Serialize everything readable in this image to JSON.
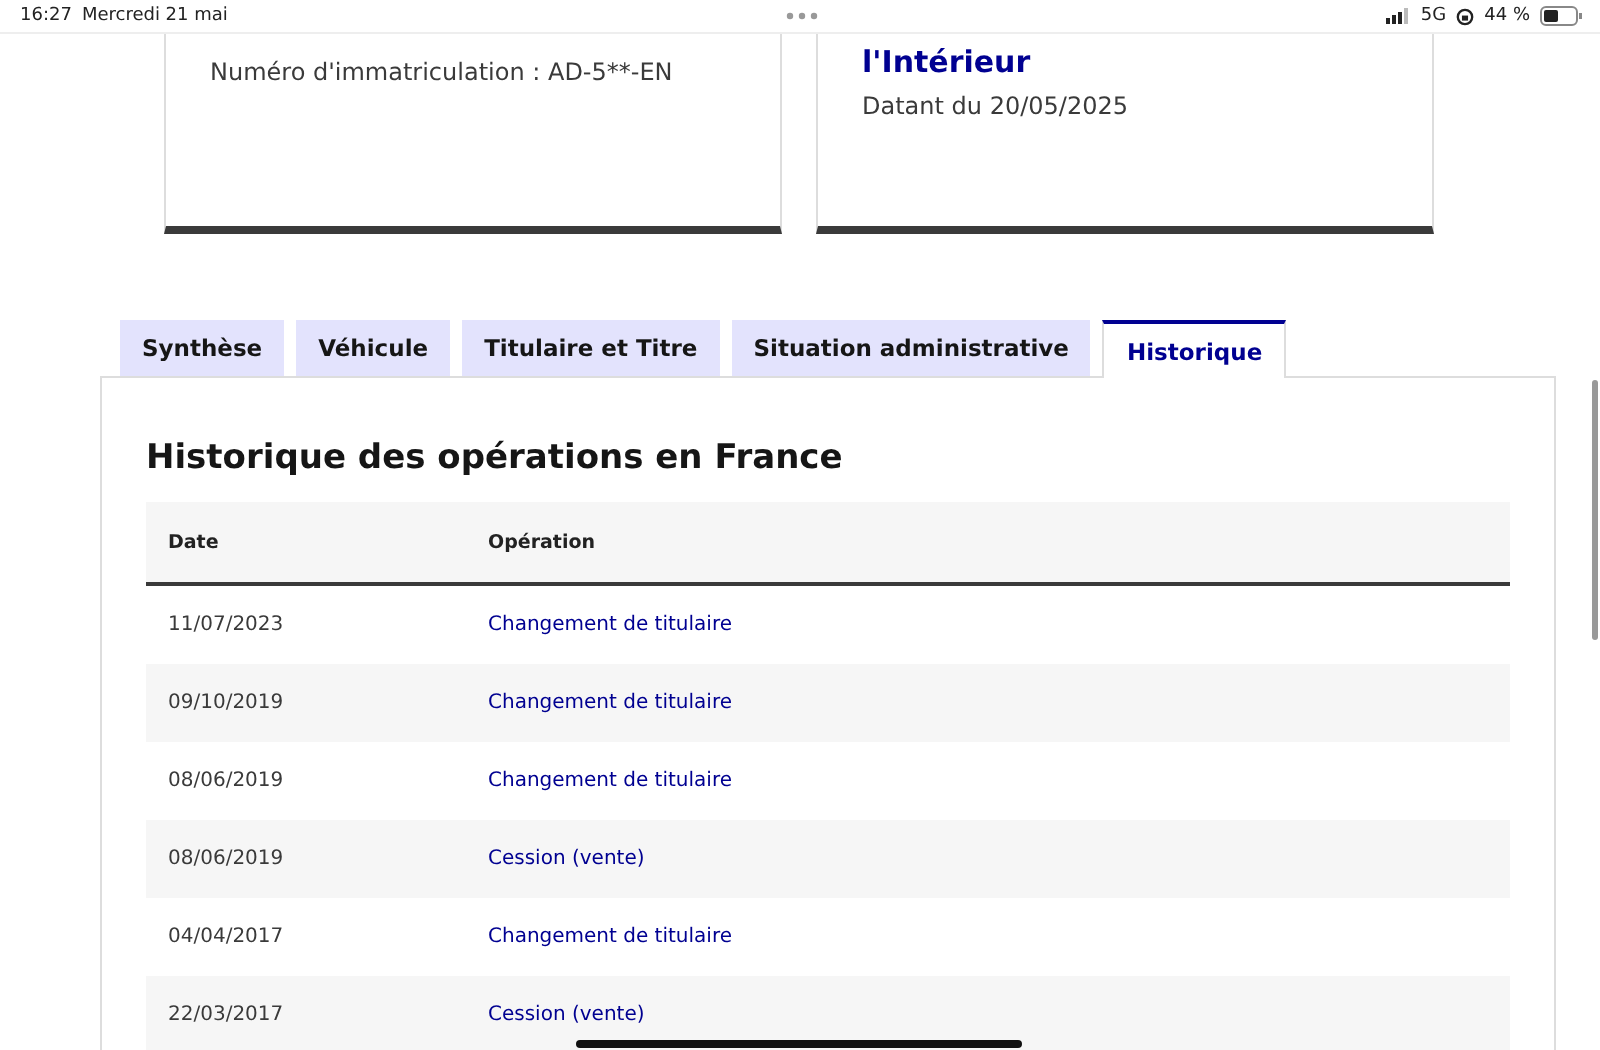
{
  "status_bar": {
    "time": "16:27",
    "date": "Mercredi 21 mai",
    "network": "5G",
    "battery": "44 %"
  },
  "cards": [
    {
      "line": "Numéro d'immatriculation : AD-5**-EN"
    },
    {
      "title": "l'Intérieur",
      "line": "Datant du 20/05/2025"
    }
  ],
  "tabs": [
    {
      "label": "Synthèse",
      "selected": false
    },
    {
      "label": "Véhicule",
      "selected": false
    },
    {
      "label": "Titulaire et Titre",
      "selected": false
    },
    {
      "label": "Situation administrative",
      "selected": false
    },
    {
      "label": "Historique",
      "selected": true
    }
  ],
  "section_title": "Historique des opérations en France",
  "table": {
    "columns": [
      "Date",
      "Opération"
    ],
    "rows": [
      [
        "11/07/2023",
        "Changement de titulaire"
      ],
      [
        "09/10/2019",
        "Changement de titulaire"
      ],
      [
        "08/06/2019",
        "Changement de titulaire"
      ],
      [
        "08/06/2019",
        "Cession (vente)"
      ],
      [
        "04/04/2017",
        "Changement de titulaire"
      ],
      [
        "22/03/2017",
        "Cession (vente)"
      ]
    ]
  }
}
